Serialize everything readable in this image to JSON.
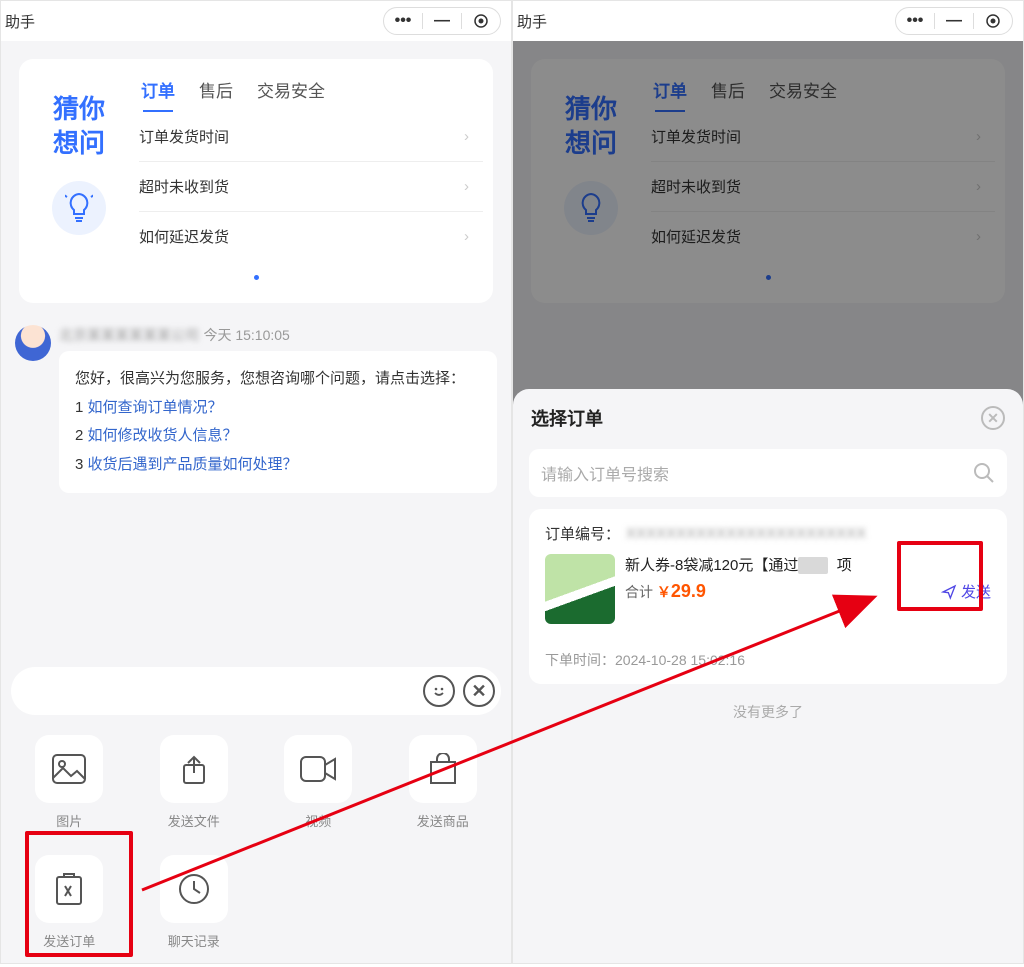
{
  "titlebar": {
    "title": "助手"
  },
  "guess": {
    "line1": "猜你",
    "line2": "想问"
  },
  "tabs": {
    "t1": "订单",
    "t2": "售后",
    "t3": "交易安全"
  },
  "faq": {
    "q1": "订单发货时间",
    "q2": "超时未收到货",
    "q3": "如何延迟发货"
  },
  "message": {
    "name": "北京某某某某某某公司",
    "time": "今天 15:10:05",
    "greeting": "您好，很高兴为您服务，您想咨询哪个问题，请点击选择：",
    "opt1_num": "1 ",
    "opt1": "如何查询订单情况？",
    "opt2_num": "2 ",
    "opt2": "如何修改收货人信息？",
    "opt3_num": "3 ",
    "opt3": "收货后遇到产品质量如何处理？"
  },
  "tools": {
    "image": "图片",
    "file": "发送文件",
    "video": "视频",
    "goods": "发送商品",
    "order": "发送订单",
    "history": "聊天记录"
  },
  "sheet": {
    "title": "选择订单",
    "search_placeholder": "请输入订单号搜索",
    "order_no_label": "订单编号：",
    "order_no": "XXXXXXXXXXXXXXXXXXXXXXXX",
    "product_title_a": "新人券-8袋减120元【通过",
    "product_title_b": "某某",
    "product_title_c": "项",
    "total_label": "合计",
    "currency": "￥",
    "price": "29.9",
    "send_label": "发送",
    "time_label": "下单时间：",
    "time_value": "2024-10-28 15:02:16",
    "no_more": "没有更多了"
  }
}
